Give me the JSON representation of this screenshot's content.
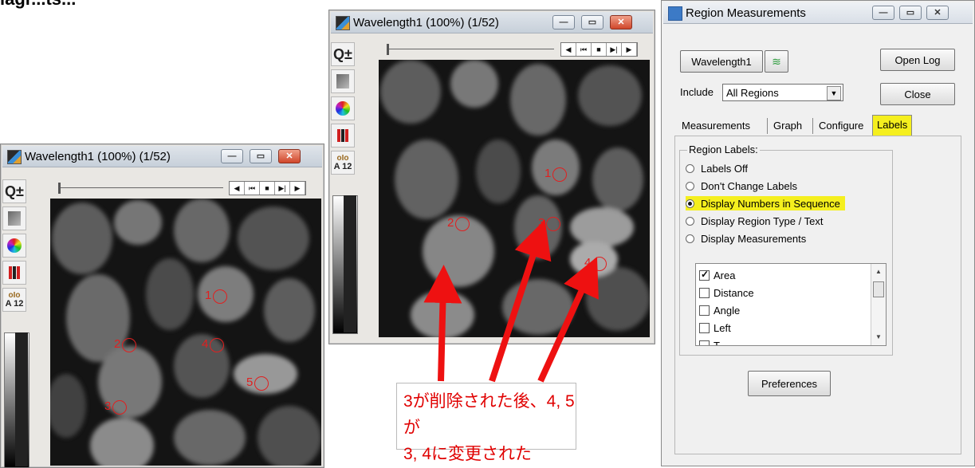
{
  "top_fragment": "iagr...ts...",
  "windows": {
    "left": {
      "title": "Wavelength1 (100%) (1/52)",
      "regions": [
        {
          "label": "1"
        },
        {
          "label": "2"
        },
        {
          "label": "4"
        },
        {
          "label": "5"
        },
        {
          "label": "3"
        }
      ]
    },
    "middle": {
      "title": "Wavelength1 (100%) (1/52)",
      "regions": [
        {
          "label": "1"
        },
        {
          "label": "2"
        },
        {
          "label": "3"
        },
        {
          "label": "4"
        }
      ]
    },
    "toolbar": {
      "scale_text": "A 12",
      "play_controls": [
        "◀",
        "⏮",
        "■",
        "▶|",
        "▶"
      ]
    }
  },
  "dialog": {
    "title": "Region Measurements",
    "image_button": "Wavelength1",
    "open_log": "Open Log",
    "include_label": "Include",
    "include_value": "All Regions",
    "close": "Close",
    "tabs": [
      "Measurements",
      "Graph",
      "Configure",
      "Labels"
    ],
    "active_tab": "Labels",
    "region_labels_title": "Region Labels:",
    "radio_options": [
      {
        "label": "Labels Off",
        "selected": false
      },
      {
        "label": "Don't Change Labels",
        "selected": false
      },
      {
        "label": "Display Numbers in Sequence",
        "selected": true
      },
      {
        "label": "Display Region Type / Text",
        "selected": false
      },
      {
        "label": "Display Measurements",
        "selected": false
      }
    ],
    "measurements": [
      {
        "label": "Area",
        "checked": true
      },
      {
        "label": "Distance",
        "checked": false
      },
      {
        "label": "Angle",
        "checked": false
      },
      {
        "label": "Left",
        "checked": false
      },
      {
        "label": "T...",
        "checked": false
      }
    ],
    "preferences": "Preferences"
  },
  "annotation": {
    "line1": "3が削除された後、4, 5が",
    "line2": "3, 4に変更された"
  },
  "colors": {
    "highlight": "#f5ef1e",
    "annotation_red": "#e00000",
    "arrow_red": "#ee1111"
  }
}
